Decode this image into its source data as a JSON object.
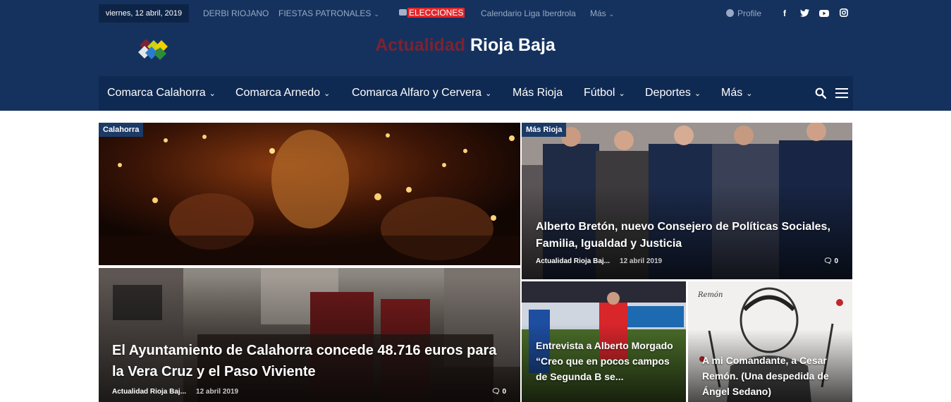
{
  "topbar": {
    "date": "viernes, 12 abril, 2019",
    "links": [
      "DERBI RIOJANO",
      "FIESTAS PATRONALES",
      "ELECCIONES",
      "Calendario Liga Iberdrola",
      "Más"
    ],
    "profile": "Profile",
    "social_icons": [
      "facebook-icon",
      "twitter-icon",
      "youtube-icon",
      "instagram-icon"
    ]
  },
  "site": {
    "title_part1": "Actualidad",
    "title_part2": "Rioja Baja",
    "accent": "#7b2332",
    "header_bg": "#15325e"
  },
  "nav": {
    "items": [
      "Comarca Calahorra",
      "Comarca Arnedo",
      "Comarca Alfaro y Cervera",
      "Más Rioja",
      "Fútbol",
      "Deportes",
      "Más"
    ]
  },
  "cards": {
    "main": {
      "category": "Calahorra",
      "title": "El Ayuntamiento de Calahorra concede 48.716 euros para la Vera Cruz y el Paso Viviente",
      "author": "Actualidad Rioja Baj...",
      "date": "12 abril 2019",
      "comments": "0"
    },
    "top_right": {
      "category": "Más Rioja",
      "title": "Alberto Bretón, nuevo Consejero de Políticas Sociales, Familia, Igualdad y Justicia",
      "author": "Actualidad Rioja Baj...",
      "date": "12 abril 2019",
      "comments": "0"
    },
    "bottom_left": {
      "title": "Entrevista a Alberto Morgado “Creo que en pocos campos de Segunda B se..."
    },
    "bottom_right": {
      "title": "A mi Comandante, a Cesar Remón. (Una despedida de Ángel Sedano)",
      "sketch_text": "Remón"
    }
  }
}
